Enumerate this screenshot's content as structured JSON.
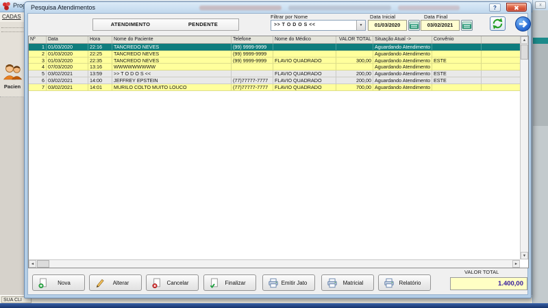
{
  "background": {
    "window_title": "Prog",
    "menu_item": "CADAS",
    "toolbar_item": "Pacien",
    "statusbar_text": "SUA CLI"
  },
  "right_window": {
    "close_glyph": "x"
  },
  "icons": {
    "help": "?",
    "up": "▲",
    "down": "▼",
    "left": "◄",
    "right": "►",
    "dropdown": "▼"
  },
  "dialog": {
    "title": "Pesquisa Atendimentos",
    "tabs": [
      {
        "label": "ATENDIMENTO"
      },
      {
        "label": "PENDENTE"
      }
    ],
    "filter": {
      "label": "Filtrar por Nome",
      "value": ">> T O D O S <<"
    },
    "date_start": {
      "label": "Data Inicial",
      "value": "01/03/2020"
    },
    "date_end": {
      "label": "Data Final",
      "value": "03/02/2021"
    },
    "table": {
      "columns": [
        "Nº",
        "Data",
        "Hora",
        "Nome do Paciente",
        "Telefone",
        "Nome do Médico",
        "VALOR TOTAL",
        "Situação Atual ->",
        "Convênio"
      ],
      "rows": [
        {
          "num": "1",
          "data": "01/03/2020",
          "hora": "22:16",
          "nome": "TANCREDO NEVES",
          "telefone": "(99) 9999-9999",
          "medico": "",
          "valor": "",
          "situacao": "Aguardando Atendimento",
          "convenio": "",
          "tone": "selected"
        },
        {
          "num": "2",
          "data": "01/03/2020",
          "hora": "22:25",
          "nome": "TANCREDO NEVES",
          "telefone": "(99) 9999-9999",
          "medico": "",
          "valor": "",
          "situacao": "Aguardando Atendimento",
          "convenio": "",
          "tone": "yellow"
        },
        {
          "num": "3",
          "data": "01/03/2020",
          "hora": "22:35",
          "nome": "TANCREDO NEVES",
          "telefone": "(99) 9999-9999",
          "medico": "FLAVIO QUADRADO",
          "valor": "300,00",
          "situacao": "Aguardando Atendimento",
          "convenio": "ESTE",
          "tone": "yellow"
        },
        {
          "num": "4",
          "data": "07/03/2020",
          "hora": "13:16",
          "nome": "WWWWWWWWW",
          "telefone": "",
          "medico": "",
          "valor": "",
          "situacao": "Aguardando Atendimento",
          "convenio": "",
          "tone": "yellow"
        },
        {
          "num": "5",
          "data": "03/02/2021",
          "hora": "13:59",
          "nome": ">> T O D O S <<",
          "telefone": "",
          "medico": "FLAVIO QUADRADO",
          "valor": "200,00",
          "situacao": "Aguardando Atendimento",
          "convenio": "ESTE",
          "tone": "plain"
        },
        {
          "num": "6",
          "data": "03/02/2021",
          "hora": "14:00",
          "nome": "JEFFREY EPSTEIN",
          "telefone": "(77)77777-7777",
          "medico": "FLAVIO QUADRADO",
          "valor": "200,00",
          "situacao": "Aguardando Atendimento",
          "convenio": "ESTE",
          "tone": "plain"
        },
        {
          "num": "7",
          "data": "03/02/2021",
          "hora": "14:01",
          "nome": "MURILO COLTO MUITO LOUCO",
          "telefone": "(77)77777-7777",
          "medico": "FLAVIO QUADRADO",
          "valor": "700,00",
          "situacao": "Aguardando Atendimento",
          "convenio": "",
          "tone": "yellow"
        }
      ]
    },
    "buttons": [
      {
        "label": "Nova",
        "icon": "doc-plus-icon"
      },
      {
        "label": "Alterar",
        "icon": "pencil-icon"
      },
      {
        "label": "Cancelar",
        "icon": "doc-cancel-icon"
      },
      {
        "label": "Finalizar",
        "icon": "doc-check-icon"
      },
      {
        "label": "Emitir Jato",
        "icon": "printer-icon"
      },
      {
        "label": "Matricial",
        "icon": "printer-icon"
      },
      {
        "label": "Relatório",
        "icon": "printer-icon"
      }
    ],
    "total": {
      "label": "VALOR TOTAL",
      "value": "1.400,00"
    }
  }
}
